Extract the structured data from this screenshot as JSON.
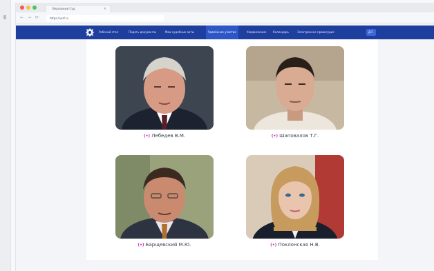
{
  "browser": {
    "tab_title": "Верховный Суд",
    "tab_close": "×",
    "url": "https://vsrf.ru",
    "nav_back": "←",
    "nav_forward": "→",
    "nav_reload": "⟳"
  },
  "site_nav": {
    "links": [
      "Рабочий стол",
      "Подать документы",
      "Мои судебные акты",
      "Удалённое участие",
      "Уведомления",
      "Календарь",
      "Электронное правосудие"
    ],
    "active_index": 3,
    "button_label": "Д.Г."
  },
  "people": [
    {
      "badge": "(•)",
      "name": "Лебедев В.М."
    },
    {
      "badge": "(•)",
      "name": "Шаповалов Т.Г."
    },
    {
      "badge": "(•)",
      "name": "Барщевский М.Ю."
    },
    {
      "badge": "(•)",
      "name": "Поклонская Н.В."
    }
  ],
  "colors": {
    "nav_bar": "#1f3f9e",
    "badge": "#c03ab4",
    "page_bg": "#ffffff"
  }
}
